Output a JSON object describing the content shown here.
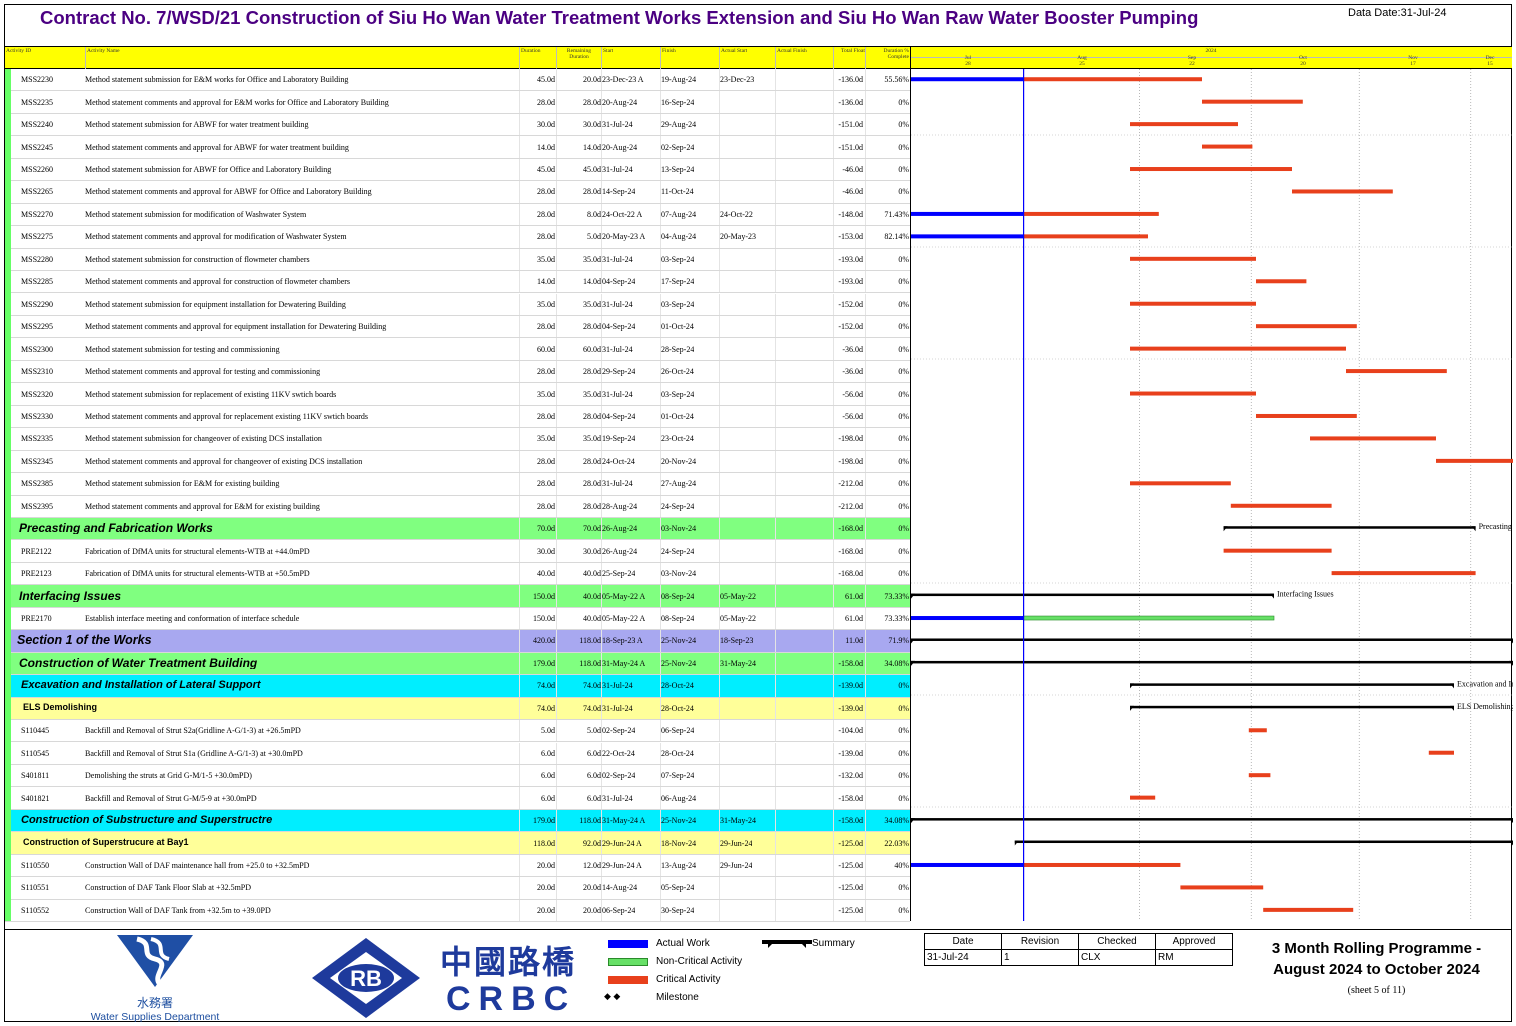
{
  "title": "Contract No. 7/WSD/21 Construction of Siu Ho Wan Water Treatment Works Extension and Siu Ho Wan Raw Water Booster Pumping",
  "data_date": "Data Date:31-Jul-24",
  "columns": {
    "id": "Activity ID",
    "name": "Activity Name",
    "dur": "Duration",
    "rem": "Remaining Duration",
    "start": "Start",
    "finish": "Finish",
    "astart": "Actual Start",
    "afinish": "Actual Finish",
    "float": "Total Float",
    "pct": "Duration % Complete"
  },
  "timeline": {
    "year": "2024",
    "months": [
      "Jul",
      "Aug",
      "Sep",
      "Oct",
      "Nov",
      "Dec"
    ],
    "dates": [
      "28",
      "25",
      "22",
      "20",
      "17",
      "15"
    ]
  },
  "colors": {
    "actual": "#0000ff",
    "critical": "#e8401c",
    "noncritical": "#66e066",
    "summary": "#000000",
    "data_date_line": "#0000ff"
  },
  "rows": [
    {
      "id": "MSS2230",
      "name": "Method statement submission for E&M works for Office and Laboratory Building",
      "dur": "45.0d",
      "rem": "20.0d",
      "start": "23-Dec-23 A",
      "finish": "19-Aug-24",
      "astart": "23-Dec-23",
      "float": "-136.0d",
      "pct": "55.56%"
    },
    {
      "id": "MSS2235",
      "name": "Method statement comments and approval for E&M works for Office and Laboratory Building",
      "dur": "28.0d",
      "rem": "28.0d",
      "start": "20-Aug-24",
      "finish": "16-Sep-24",
      "astart": "",
      "float": "-136.0d",
      "pct": "0%"
    },
    {
      "id": "MSS2240",
      "name": "Method statement submission for ABWF for water treatment building",
      "dur": "30.0d",
      "rem": "30.0d",
      "start": "31-Jul-24",
      "finish": "29-Aug-24",
      "astart": "",
      "float": "-151.0d",
      "pct": "0%"
    },
    {
      "id": "MSS2245",
      "name": "Method statement comments and approval for ABWF for water treatment building",
      "dur": "14.0d",
      "rem": "14.0d",
      "start": "20-Aug-24",
      "finish": "02-Sep-24",
      "astart": "",
      "float": "-151.0d",
      "pct": "0%"
    },
    {
      "id": "MSS2260",
      "name": "Method statement submission for ABWF for Office and Laboratory Building",
      "dur": "45.0d",
      "rem": "45.0d",
      "start": "31-Jul-24",
      "finish": "13-Sep-24",
      "astart": "",
      "float": "-46.0d",
      "pct": "0%"
    },
    {
      "id": "MSS2265",
      "name": "Method statement comments and approval for ABWF for Office and Laboratory Building",
      "dur": "28.0d",
      "rem": "28.0d",
      "start": "14-Sep-24",
      "finish": "11-Oct-24",
      "astart": "",
      "float": "-46.0d",
      "pct": "0%"
    },
    {
      "id": "MSS2270",
      "name": "Method statement submission for modification of Washwater System",
      "dur": "28.0d",
      "rem": "8.0d",
      "start": "24-Oct-22 A",
      "finish": "07-Aug-24",
      "astart": "24-Oct-22",
      "float": "-148.0d",
      "pct": "71.43%"
    },
    {
      "id": "MSS2275",
      "name": "Method statement comments and approval for modification of Washwater System",
      "dur": "28.0d",
      "rem": "5.0d",
      "start": "20-May-23 A",
      "finish": "04-Aug-24",
      "astart": "20-May-23",
      "float": "-153.0d",
      "pct": "82.14%"
    },
    {
      "id": "MSS2280",
      "name": "Method statement submission for construction of flowmeter chambers",
      "dur": "35.0d",
      "rem": "35.0d",
      "start": "31-Jul-24",
      "finish": "03-Sep-24",
      "astart": "",
      "float": "-193.0d",
      "pct": "0%"
    },
    {
      "id": "MSS2285",
      "name": "Method statement comments and approval for construction of flowmeter chambers",
      "dur": "14.0d",
      "rem": "14.0d",
      "start": "04-Sep-24",
      "finish": "17-Sep-24",
      "astart": "",
      "float": "-193.0d",
      "pct": "0%"
    },
    {
      "id": "MSS2290",
      "name": "Method statement submission for equipment installation for Dewatering Building",
      "dur": "35.0d",
      "rem": "35.0d",
      "start": "31-Jul-24",
      "finish": "03-Sep-24",
      "astart": "",
      "float": "-152.0d",
      "pct": "0%"
    },
    {
      "id": "MSS2295",
      "name": "Method statement comments and approval for equipment installation for Dewatering Building",
      "dur": "28.0d",
      "rem": "28.0d",
      "start": "04-Sep-24",
      "finish": "01-Oct-24",
      "astart": "",
      "float": "-152.0d",
      "pct": "0%"
    },
    {
      "id": "MSS2300",
      "name": "Method statement submission for testing and commissioning",
      "dur": "60.0d",
      "rem": "60.0d",
      "start": "31-Jul-24",
      "finish": "28-Sep-24",
      "astart": "",
      "float": "-36.0d",
      "pct": "0%"
    },
    {
      "id": "MSS2310",
      "name": "Method statement comments and approval for testing and commissioning",
      "dur": "28.0d",
      "rem": "28.0d",
      "start": "29-Sep-24",
      "finish": "26-Oct-24",
      "astart": "",
      "float": "-36.0d",
      "pct": "0%"
    },
    {
      "id": "MSS2320",
      "name": "Method statement submission for replacement of existing 11KV swtich boards",
      "dur": "35.0d",
      "rem": "35.0d",
      "start": "31-Jul-24",
      "finish": "03-Sep-24",
      "astart": "",
      "float": "-56.0d",
      "pct": "0%"
    },
    {
      "id": "MSS2330",
      "name": "Method statement comments and approval for replacement existing 11KV swtich boards",
      "dur": "28.0d",
      "rem": "28.0d",
      "start": "04-Sep-24",
      "finish": "01-Oct-24",
      "astart": "",
      "float": "-56.0d",
      "pct": "0%"
    },
    {
      "id": "MSS2335",
      "name": "Method statement submission for changeover of existing DCS installation",
      "dur": "35.0d",
      "rem": "35.0d",
      "start": "19-Sep-24",
      "finish": "23-Oct-24",
      "astart": "",
      "float": "-198.0d",
      "pct": "0%"
    },
    {
      "id": "MSS2345",
      "name": "Method statement comments and approval for changeover of existing DCS installation",
      "dur": "28.0d",
      "rem": "28.0d",
      "start": "24-Oct-24",
      "finish": "20-Nov-24",
      "astart": "",
      "float": "-198.0d",
      "pct": "0%"
    },
    {
      "id": "MSS2385",
      "name": "Method statement submission for E&M for existing building",
      "dur": "28.0d",
      "rem": "28.0d",
      "start": "31-Jul-24",
      "finish": "27-Aug-24",
      "astart": "",
      "float": "-212.0d",
      "pct": "0%"
    },
    {
      "id": "MSS2395",
      "name": "Method statement comments and approval for E&M for existing building",
      "dur": "28.0d",
      "rem": "28.0d",
      "start": "28-Aug-24",
      "finish": "24-Sep-24",
      "astart": "",
      "float": "-212.0d",
      "pct": "0%"
    },
    {
      "id": "",
      "name": "Precasting and Fabrication Works",
      "dur": "70.0d",
      "rem": "70.0d",
      "start": "26-Aug-24",
      "finish": "03-Nov-24",
      "astart": "",
      "float": "-168.0d",
      "pct": "0%",
      "group": "green",
      "gl": "Precasting and Fabrication Works"
    },
    {
      "id": "PRE2122",
      "name": "Fabrication of DfMA units for structural elements-WTB at +44.0mPD",
      "dur": "30.0d",
      "rem": "30.0d",
      "start": "26-Aug-24",
      "finish": "24-Sep-24",
      "astart": "",
      "float": "-168.0d",
      "pct": "0%"
    },
    {
      "id": "PRE2123",
      "name": "Fabrication of DfMA units for structural elements-WTB at +50.5mPD",
      "dur": "40.0d",
      "rem": "40.0d",
      "start": "25-Sep-24",
      "finish": "03-Nov-24",
      "astart": "",
      "float": "-168.0d",
      "pct": "0%"
    },
    {
      "id": "",
      "name": "Interfacing Issues",
      "dur": "150.0d",
      "rem": "40.0d",
      "start": "05-May-22 A",
      "finish": "08-Sep-24",
      "astart": "05-May-22",
      "float": "61.0d",
      "pct": "73.33%",
      "group": "green",
      "gl": "Interfacing Issues"
    },
    {
      "id": "PRE2170",
      "name": "Establish interface meeting and conformation of interface schedule",
      "dur": "150.0d",
      "rem": "40.0d",
      "start": "05-May-22 A",
      "finish": "08-Sep-24",
      "astart": "05-May-22",
      "float": "61.0d",
      "pct": "73.33%"
    },
    {
      "id": "",
      "name": "Section 1 of the Works",
      "dur": "420.0d",
      "rem": "118.0d",
      "start": "18-Sep-23 A",
      "finish": "25-Nov-24",
      "astart": "18-Sep-23",
      "float": "11.0d",
      "pct": "71.9%",
      "group": "purple",
      "gl": "Section 1 of the"
    },
    {
      "id": "",
      "name": "Construction of Water Treatment Building",
      "dur": "179.0d",
      "rem": "118.0d",
      "start": "31-May-24 A",
      "finish": "25-Nov-24",
      "astart": "31-May-24",
      "float": "-158.0d",
      "pct": "34.08%",
      "group": "green",
      "gl": "Construction of"
    },
    {
      "id": "",
      "name": "Excavation and Installation of Lateral Support",
      "dur": "74.0d",
      "rem": "74.0d",
      "start": "31-Jul-24",
      "finish": "28-Oct-24",
      "astart": "",
      "float": "-139.0d",
      "pct": "0%",
      "group": "cyan",
      "gl": "Excavation and Installation of Lateral Suppor"
    },
    {
      "id": "",
      "name": "ELS Demolishing",
      "dur": "74.0d",
      "rem": "74.0d",
      "start": "31-Jul-24",
      "finish": "28-Oct-24",
      "astart": "",
      "float": "-139.0d",
      "pct": "0%",
      "group": "yellow",
      "gl": "ELS Demolishing"
    },
    {
      "id": "S110445",
      "name": "Backfill and Removal of Strut S2a(Gridline A-G/1-3) at +26.5mPD",
      "dur": "5.0d",
      "rem": "5.0d",
      "start": "02-Sep-24",
      "finish": "06-Sep-24",
      "astart": "",
      "float": "-104.0d",
      "pct": "0%"
    },
    {
      "id": "S110545",
      "name": "Backfill and Removal of Strut S1a (Gridline A-G/1-3) at +30.0mPD",
      "dur": "6.0d",
      "rem": "6.0d",
      "start": "22-Oct-24",
      "finish": "28-Oct-24",
      "astart": "",
      "float": "-139.0d",
      "pct": "0%"
    },
    {
      "id": "S401811",
      "name": "Demolishing the struts at  Grid  G-M/1-5 +30.0mPD)",
      "dur": "6.0d",
      "rem": "6.0d",
      "start": "02-Sep-24",
      "finish": "07-Sep-24",
      "astart": "",
      "float": "-132.0d",
      "pct": "0%"
    },
    {
      "id": "S401821",
      "name": "Backfill and Removal of Strut G-M/5-9 at +30.0mPD",
      "dur": "6.0d",
      "rem": "6.0d",
      "start": "31-Jul-24",
      "finish": "06-Aug-24",
      "astart": "",
      "float": "-158.0d",
      "pct": "0%"
    },
    {
      "id": "",
      "name": "Construction of Substructure and Superstructre",
      "dur": "179.0d",
      "rem": "118.0d",
      "start": "31-May-24 A",
      "finish": "25-Nov-24",
      "astart": "31-May-24",
      "float": "-158.0d",
      "pct": "34.08%",
      "group": "cyan",
      "gl": "Construction of"
    },
    {
      "id": "",
      "name": "Construction of Superstrucure at Bay1",
      "dur": "118.0d",
      "rem": "92.0d",
      "start": "29-Jun-24 A",
      "finish": "18-Nov-24",
      "astart": "29-Jun-24",
      "float": "-125.0d",
      "pct": "22.03%",
      "group": "yellow",
      "gl": "Construction of Superst"
    },
    {
      "id": "S110550",
      "name": "Construction Wall of DAF maintenance hall from +25.0 to +32.5mPD",
      "dur": "20.0d",
      "rem": "12.0d",
      "start": "29-Jun-24 A",
      "finish": "13-Aug-24",
      "astart": "29-Jun-24",
      "float": "-125.0d",
      "pct": "40%"
    },
    {
      "id": "S110551",
      "name": "Construction of DAF Tank Floor Slab at +32.5mPD",
      "dur": "20.0d",
      "rem": "20.0d",
      "start": "14-Aug-24",
      "finish": "05-Sep-24",
      "astart": "",
      "float": "-125.0d",
      "pct": "0%"
    },
    {
      "id": "S110552",
      "name": "Construction Wall of DAF Tank from +32.5m to +39.0PD",
      "dur": "20.0d",
      "rem": "20.0d",
      "start": "06-Sep-24",
      "finish": "30-Sep-24",
      "astart": "",
      "float": "-125.0d",
      "pct": "0%"
    }
  ],
  "legend": {
    "actual": "Actual Work",
    "noncritical": "Non-Critical Activity",
    "critical": "Critical Activity",
    "milestone": "Milestone",
    "summary": "Summary"
  },
  "revision": {
    "headers": [
      "Date",
      "Revision",
      "Checked",
      "Approved"
    ],
    "values": [
      "31-Jul-24",
      "1",
      "CLX",
      "RM"
    ]
  },
  "programme_title": [
    "3 Month Rolling Programme -",
    "August 2024 to October 2024"
  ],
  "sheet": "(sheet 5 of 11)",
  "wsd": {
    "cn": "水務署",
    "en": "Water Supplies Department"
  },
  "crbc": {
    "rb": "RB",
    "cn": "中國路橋",
    "en": "CRBC"
  }
}
